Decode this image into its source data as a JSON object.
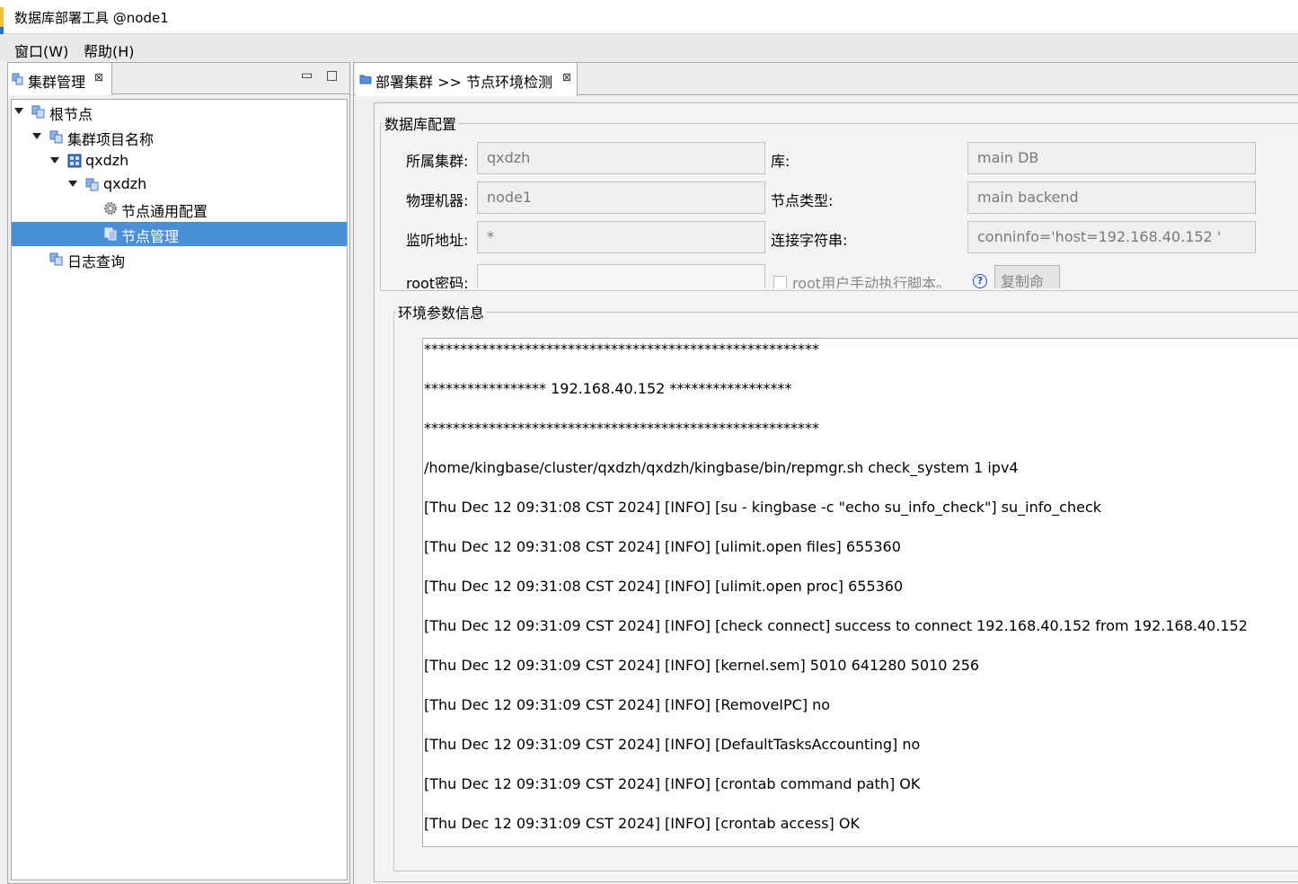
{
  "window": {
    "title": "数据库部署工具 @node1"
  },
  "menu": {
    "items": [
      "窗口(W)",
      "帮助(H)"
    ]
  },
  "left_panel": {
    "tab_label": "集群管理",
    "tree": [
      {
        "label": "根节点",
        "icon": "cluster-icon",
        "expanded": true
      },
      {
        "label": "集群项目名称",
        "icon": "cluster-icon",
        "expanded": true
      },
      {
        "label": "qxdzh",
        "icon": "server-group-icon",
        "expanded": true
      },
      {
        "label": "qxdzh",
        "icon": "cluster-icon",
        "expanded": true
      },
      {
        "label": "节点通用配置",
        "icon": "gear-icon"
      },
      {
        "label": "节点管理",
        "icon": "node-icon",
        "selected": true
      },
      {
        "label": "日志查询",
        "icon": "cluster-icon"
      }
    ]
  },
  "right_panel": {
    "tab_label": "部署集群 >> 节点环境检测",
    "db_config": {
      "legend": "数据库配置",
      "cluster_label": "所属集群:",
      "cluster_value": "qxdzh",
      "db_label": "库:",
      "db_value": "main DB",
      "machine_label": "物理机器:",
      "machine_value": "node1",
      "node_type_label": "节点类型:",
      "node_type_value": "main backend",
      "listen_label": "监听地址:",
      "listen_value": "*",
      "conn_label": "连接字符串:",
      "conn_value": "conninfo='host=192.168.40.152 '",
      "root_pwd_label": "root密码:",
      "manual_script_label": "root用户手动执行脚本。",
      "copy_button_label": "复制命令"
    },
    "env_info": {
      "legend": "环境参数信息",
      "lines": [
        "*******************************************************",
        "***************** 192.168.40.152 *****************",
        "*******************************************************",
        "/home/kingbase/cluster/qxdzh/qxdzh/kingbase/bin/repmgr.sh check_system 1 ipv4",
        "[Thu Dec 12 09:31:08 CST 2024] [INFO] [su - kingbase -c \"echo su_info_check\"] su_info_check",
        "[Thu Dec 12 09:31:08 CST 2024] [INFO] [ulimit.open files] 655360",
        "[Thu Dec 12 09:31:08 CST 2024] [INFO] [ulimit.open proc] 655360",
        "[Thu Dec 12 09:31:09 CST 2024] [INFO] [check connect] success to connect 192.168.40.152 from 192.168.40.152",
        "[Thu Dec 12 09:31:09 CST 2024] [INFO] [kernel.sem] 5010 641280 5010 256",
        "[Thu Dec 12 09:31:09 CST 2024] [INFO] [RemoveIPC] no",
        "[Thu Dec 12 09:31:09 CST 2024] [INFO] [DefaultTasksAccounting] no",
        "[Thu Dec 12 09:31:09 CST 2024] [INFO] [crontab command path] OK",
        "[Thu Dec 12 09:31:09 CST 2024] [INFO] [crontab access] OK"
      ]
    }
  },
  "colors": {
    "selection": "#4a90d9",
    "icon_blue": "#5b8fd6"
  }
}
